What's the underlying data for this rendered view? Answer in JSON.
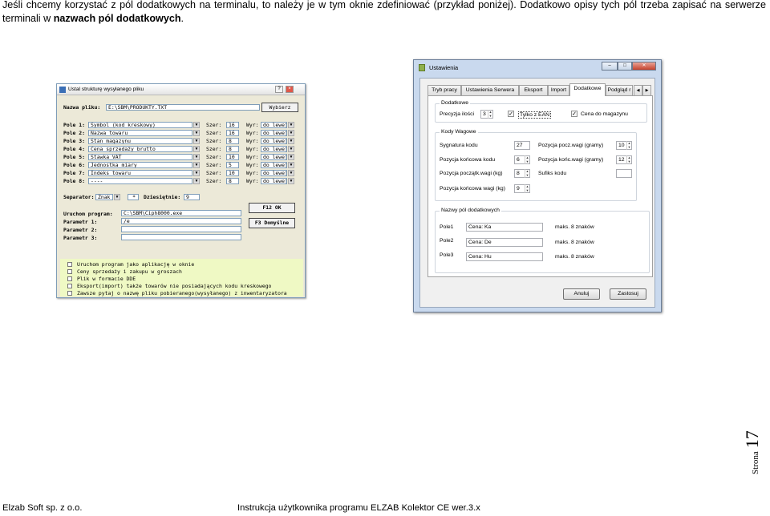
{
  "paragraph": {
    "text": "Jeśli chcemy korzystać z pól dodatkowych na terminalu, to należy je w tym oknie zdefiniować (przykład poniżej). Dodatkowo opisy tych pól trzeba zapisać na serwerze terminali w ",
    "bold": "nazwach pól dodatkowych",
    "end": "."
  },
  "left_window": {
    "title": "Ustal strukturę wysyłanego pliku",
    "file_label": "Nazwa pliku:",
    "file_value": "E:\\SBM\\PRODUKTY.TXT",
    "choose_button": "Wybierz",
    "fields": [
      {
        "label": "Pole 1:",
        "value": "Symbol (kod kreskowy)",
        "size": "16",
        "align": "do lewej"
      },
      {
        "label": "Pole 2:",
        "value": "Nazwa towaru",
        "size": "16",
        "align": "do lewej"
      },
      {
        "label": "Pole 3:",
        "value": "Stan magazynu",
        "size": "8",
        "align": "do lewej"
      },
      {
        "label": "Pole 4:",
        "value": "Cena sprzedaży brutto",
        "size": "8",
        "align": "do lewej"
      },
      {
        "label": "Pole 5:",
        "value": "Stawka VAT",
        "size": "10",
        "align": "do lewej"
      },
      {
        "label": "Pole 6:",
        "value": "Jednostka miary",
        "size": "5",
        "align": "do lewej"
      },
      {
        "label": "Pole 7:",
        "value": "Indeks towaru",
        "size": "10",
        "align": "do lewej"
      },
      {
        "label": "Pole 8:",
        "value": "----",
        "size": "8",
        "align": "do lewej"
      }
    ],
    "size_label": "Szer:",
    "align_label": "Wyr:",
    "separator_label": "Separator:",
    "separator_value": "Znak",
    "separator_char": "*",
    "decimals_label": "Dziesiętnie:",
    "decimals_value": "9",
    "run_label": "Uruchom program:",
    "run_value": "C:\\SBM\\Ciph8000.exe",
    "param1_label": "Parametr 1:",
    "param1_value": "/e",
    "param2_label": "Parametr 2:",
    "param3_label": "Parametr 3:",
    "ok_button": "F12 OK",
    "defaults_button": "F3 Domyślne",
    "options": [
      "Uruchom program jako aplikację w oknie",
      "Ceny sprzedaży i zakupu w groszach",
      "Plik w formacie DDE",
      "Eksport(import) także towarów nie posiadających kodu kreskowego",
      "Zawsze pytaj o nazwę pliku pobieranego(wysyłanego) z inwentaryzatora"
    ]
  },
  "right_window": {
    "title": "Ustawienia",
    "tabs": [
      "Tryb pracy",
      "Ustawienia Serwera",
      "Eksport",
      "Import",
      "Dodatkowe",
      "Podgląd r"
    ],
    "active_tab": "Dodatkowe",
    "grp_dodatkowe": "Dodatkowe",
    "precision_label": "Precyzja ilości",
    "precision_value": "3",
    "ean_only": "Tylko z EAN",
    "store_price": "Cena do magazynu",
    "grp_kody": "Kody Wagowe",
    "code_signature_label": "Sygnatura kodu",
    "code_signature_value": "27",
    "code_end_label": "Pozycja końcowa kodu",
    "code_end_value": "6",
    "weight_start_kg_label": "Pozycja początk.wagi (kg)",
    "weight_start_kg_value": "8",
    "weight_end_kg_label": "Pozycja końcowa wagi (kg)",
    "weight_end_kg_value": "9",
    "weight_start_g_label": "Pozycja pocz.wagi (gramy)",
    "weight_start_g_value": "10",
    "weight_end_g_label": "Pozycja końc.wagi (gramy)",
    "weight_end_g_value": "12",
    "code_suffix_label": "Sufiks kodu",
    "grp_nazwy": "Nazwy pól dodatkowych",
    "extra_fields": [
      {
        "label": "Pole1",
        "value": "Cena: Ka",
        "max": "maks. 8 znaków"
      },
      {
        "label": "Pole2",
        "value": "Cena: De",
        "max": "maks. 8 znaków"
      },
      {
        "label": "Pole3",
        "value": "Cena: Hu",
        "max": "maks. 8 znaków"
      }
    ],
    "cancel_button": "Anuluj",
    "save_button": "Zastosuj"
  },
  "footer": {
    "company": "Elzab Soft sp. z o.o.",
    "manual": "Instrukcja użytkownika programu ELZAB Kolektor CE wer.3.x",
    "page_word": "Strona",
    "page_number": "17"
  }
}
